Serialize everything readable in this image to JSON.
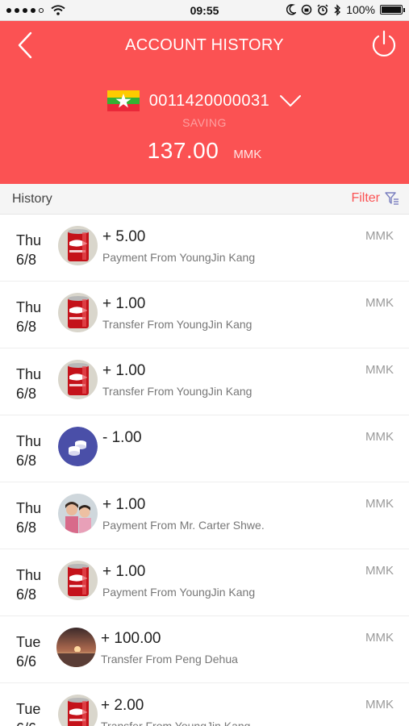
{
  "status_bar": {
    "time": "09:55",
    "battery_text": "100%",
    "battery_level": 1.0,
    "icons": [
      "signal-dots-icon",
      "wifi-icon",
      "moon-icon",
      "orientation-lock-icon",
      "alarm-icon",
      "bluetooth-icon",
      "battery-icon"
    ]
  },
  "header": {
    "title": "ACCOUNT HISTORY",
    "back_icon": "chevron-left-icon",
    "power_icon": "power-icon",
    "account_number": "0011420000031",
    "account_type": "SAVING",
    "balance": "137.00",
    "currency": "MMK",
    "flag": "myanmar-flag-icon",
    "dropdown_icon": "chevron-down-icon",
    "color": "#fb5253"
  },
  "history_bar": {
    "label": "History",
    "filter_label": "Filter",
    "filter_icon": "filter-icon"
  },
  "transactions": [
    {
      "day": "Thu",
      "date": "6/8",
      "amount": "+ 5.00",
      "description": "Payment From YoungJin Kang",
      "currency": "MMK",
      "avatar": "can-photo"
    },
    {
      "day": "Thu",
      "date": "6/8",
      "amount": "+ 1.00",
      "description": "Transfer From YoungJin Kang",
      "currency": "MMK",
      "avatar": "can-photo"
    },
    {
      "day": "Thu",
      "date": "6/8",
      "amount": "+ 1.00",
      "description": "Transfer From YoungJin Kang",
      "currency": "MMK",
      "avatar": "can-photo"
    },
    {
      "day": "Thu",
      "date": "6/8",
      "amount": "- 1.00",
      "description": "",
      "currency": "MMK",
      "avatar": "coins-icon"
    },
    {
      "day": "Thu",
      "date": "6/8",
      "amount": "+ 1.00",
      "description": "Payment From Mr. Carter Shwe.",
      "currency": "MMK",
      "avatar": "kids-photo"
    },
    {
      "day": "Thu",
      "date": "6/8",
      "amount": "+ 1.00",
      "description": "Payment From YoungJin Kang",
      "currency": "MMK",
      "avatar": "can-photo"
    },
    {
      "day": "Tue",
      "date": "6/6",
      "amount": "+ 100.00",
      "description": "Transfer From Peng Dehua",
      "currency": "MMK",
      "avatar": "sunset-photo"
    },
    {
      "day": "Tue",
      "date": "6/6",
      "amount": "+ 2.00",
      "description": "Transfer From YoungJin Kang",
      "currency": "MMK",
      "avatar": "can-photo"
    }
  ]
}
